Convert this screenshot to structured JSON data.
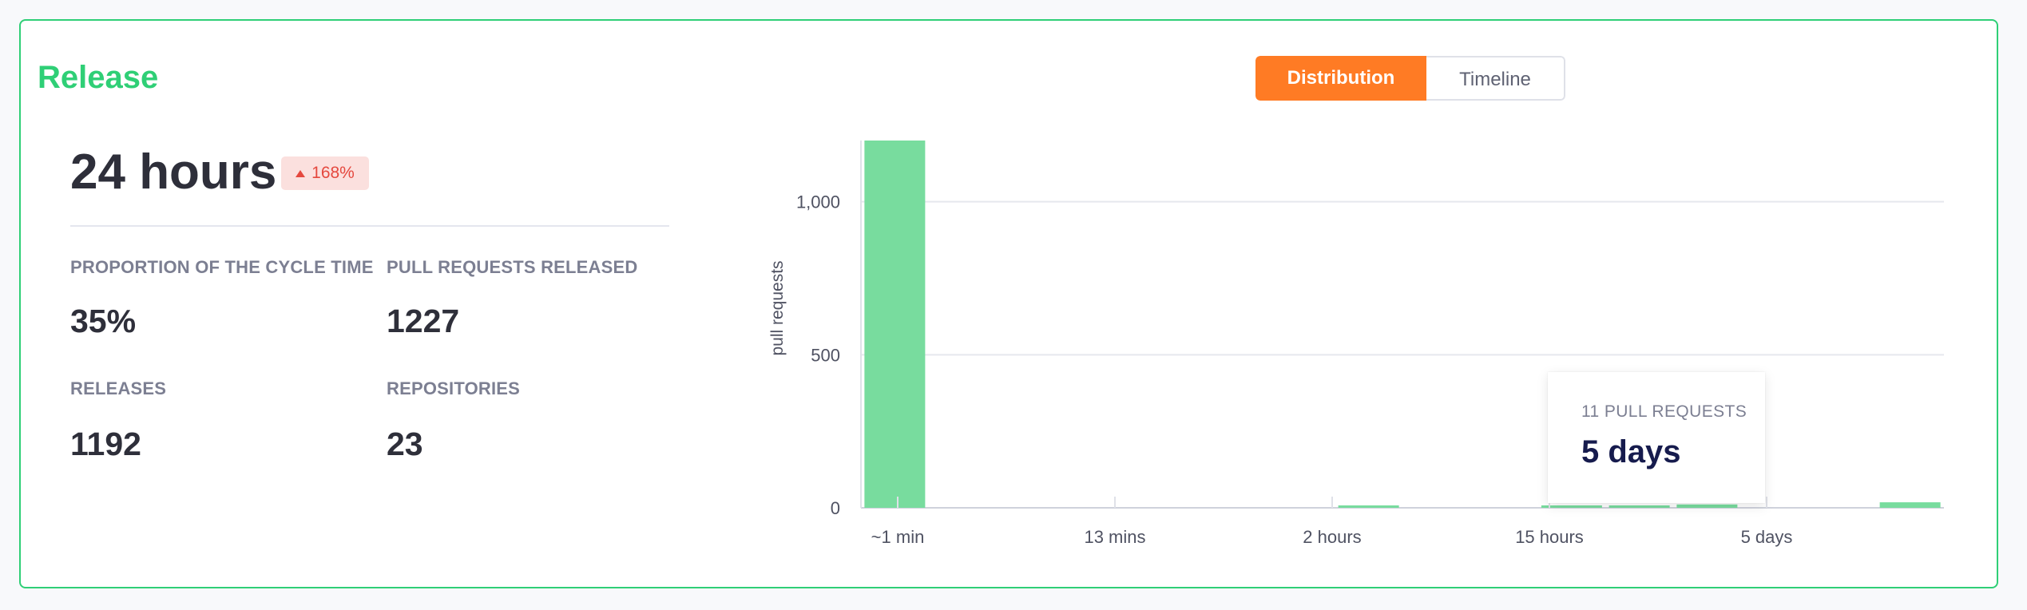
{
  "card": {
    "title": "Release",
    "main_value": "24 hours",
    "badge": {
      "text": "168%",
      "direction": "up",
      "color": "#e5483e"
    },
    "stats": [
      {
        "label": "PROPORTION OF THE CYCLE TIME",
        "value": "35%"
      },
      {
        "label": "PULL REQUESTS RELEASED",
        "value": "1227"
      },
      {
        "label": "RELEASES",
        "value": "1192"
      },
      {
        "label": "REPOSITORIES",
        "value": "23"
      }
    ],
    "accent_color": "#2fcf76"
  },
  "tabs": [
    {
      "label": "Distribution",
      "active": true
    },
    {
      "label": "Timeline",
      "active": false
    }
  ],
  "tooltip": {
    "label": "11 PULL REQUESTS",
    "value": "5 days"
  },
  "chart_data": {
    "type": "bar",
    "ylabel": "pull requests",
    "xlabel": "",
    "ylim": [
      0,
      1200
    ],
    "yticks": [
      0,
      500,
      1000
    ],
    "ytick_labels": [
      "0",
      "500",
      "1,000"
    ],
    "xtick_labels": [
      "~1 min",
      "13 mins",
      "2 hours",
      "15 hours",
      "5 days"
    ],
    "grid": true,
    "bar_color": "#78dc9e",
    "values": [
      1200,
      0,
      0,
      0,
      0,
      0,
      0,
      1,
      0,
      0,
      2,
      6,
      11,
      0,
      0,
      18
    ]
  }
}
